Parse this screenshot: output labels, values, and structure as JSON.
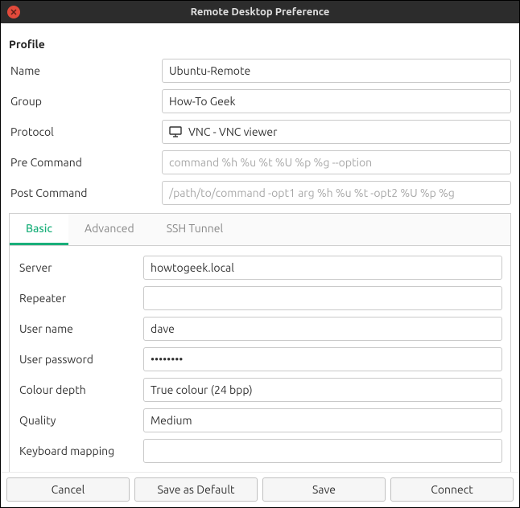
{
  "window": {
    "title": "Remote Desktop Preference"
  },
  "profile": {
    "heading": "Profile",
    "labels": {
      "name": "Name",
      "group": "Group",
      "protocol": "Protocol",
      "pre_command": "Pre Command",
      "post_command": "Post Command"
    },
    "values": {
      "name": "Ubuntu-Remote",
      "group": "How-To Geek",
      "protocol": "VNC - VNC viewer"
    },
    "placeholders": {
      "pre_command": "command %h %u %t %U %p %g --option",
      "post_command": "/path/to/command -opt1 arg %h %u %t -opt2 %U %p %g"
    }
  },
  "tabs": {
    "basic": "Basic",
    "advanced": "Advanced",
    "ssh_tunnel": "SSH Tunnel"
  },
  "basic": {
    "labels": {
      "server": "Server",
      "repeater": "Repeater",
      "user_name": "User name",
      "user_password": "User password",
      "colour_depth": "Colour depth",
      "quality": "Quality",
      "keyboard_mapping": "Keyboard mapping"
    },
    "values": {
      "server": "howtogeek.local",
      "repeater": "",
      "user_name": "dave",
      "user_password": "••••••••",
      "colour_depth": "True colour (24 bpp)",
      "quality": "Medium",
      "keyboard_mapping": ""
    }
  },
  "buttons": {
    "cancel": "Cancel",
    "save_default": "Save as Default",
    "save": "Save",
    "connect": "Connect"
  }
}
